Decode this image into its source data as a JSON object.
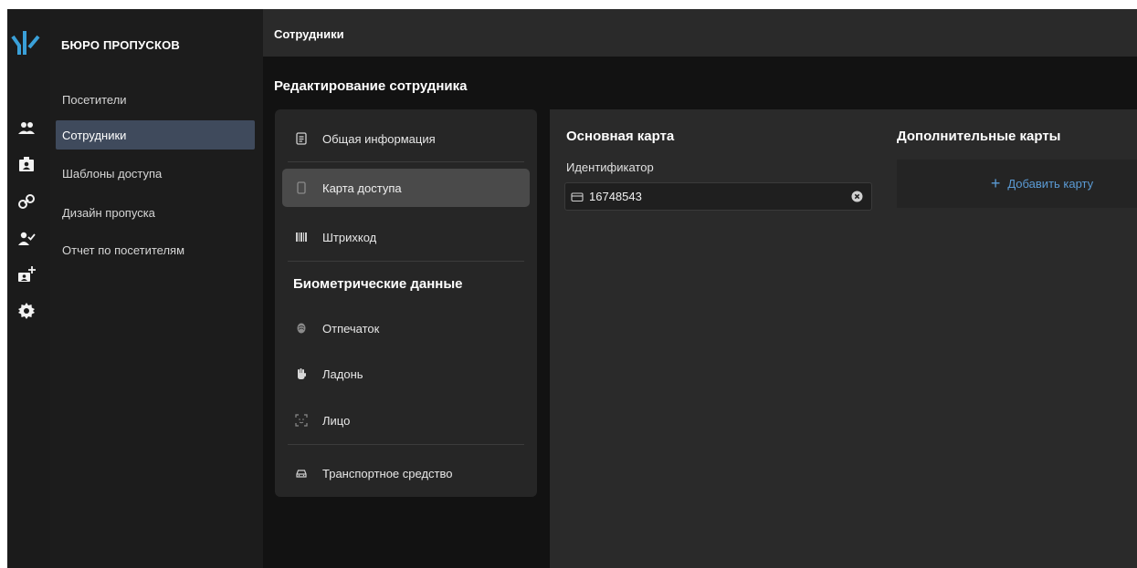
{
  "sidebar": {
    "brand": "БЮРО ПРОПУСКОВ",
    "items": [
      {
        "label": "Посетители"
      },
      {
        "label": "Сотрудники",
        "active": true
      },
      {
        "label": "Шаблоны доступа"
      },
      {
        "label": "Дизайн пропуска"
      },
      {
        "label": "Отчет по посетителям"
      }
    ]
  },
  "rail_icons": [
    "visitors-icon",
    "employees-badge-icon",
    "link-icon",
    "user-check-icon",
    "badge-add-icon",
    "gear-icon"
  ],
  "topbar": {
    "title": "Сотрудники"
  },
  "page": {
    "title": "Редактирование сотрудника"
  },
  "menu": {
    "general": "Общая информация",
    "access_card": "Карта доступа",
    "barcode": "Штрихкод",
    "bio_heading": "Биометрические данные",
    "fingerprint": "Отпечаток",
    "palm": "Ладонь",
    "face": "Лицо",
    "vehicle": "Транспортное средство"
  },
  "main_card": {
    "title": "Основная карта",
    "id_label": "Идентификатор",
    "id_value": "16748543"
  },
  "extra_cards": {
    "title": "Дополнительные карты",
    "add_label": "Добавить карту",
    "add_symbol": "+"
  },
  "colors": {
    "accent": "#5b9bd5",
    "active_nav": "#3f4a5c",
    "logo": "#3aa0d8"
  }
}
